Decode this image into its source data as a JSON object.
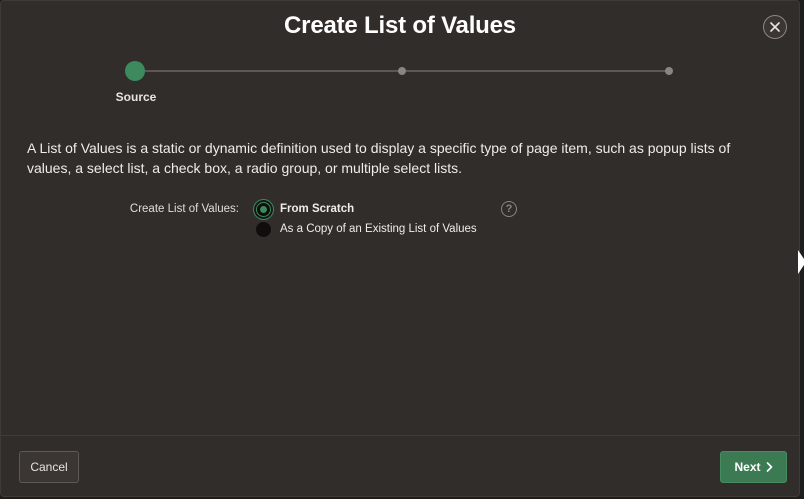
{
  "dialog": {
    "title": "Create List of Values",
    "close_icon": "close-icon"
  },
  "wizard": {
    "steps": [
      {
        "label": "Source",
        "state": "active"
      },
      {
        "label": "",
        "state": "upcoming"
      },
      {
        "label": "",
        "state": "upcoming"
      }
    ],
    "active_color": "#3c8a5e"
  },
  "main": {
    "description": "A List of Values is a static or dynamic definition used to display a specific type of page item, such as popup lists of values, a select list, a check box, a radio group, or multiple select lists.",
    "field": {
      "label": "Create List of Values:",
      "options": [
        {
          "label": "From Scratch",
          "checked": true
        },
        {
          "label": "As a Copy of an Existing List of Values",
          "checked": false
        }
      ],
      "help_icon": "help-icon",
      "help_glyph": "?"
    }
  },
  "footer": {
    "cancel_label": "Cancel",
    "next_label": "Next",
    "next_icon": "chevron-right-icon",
    "primary_color": "#3c7a53"
  }
}
